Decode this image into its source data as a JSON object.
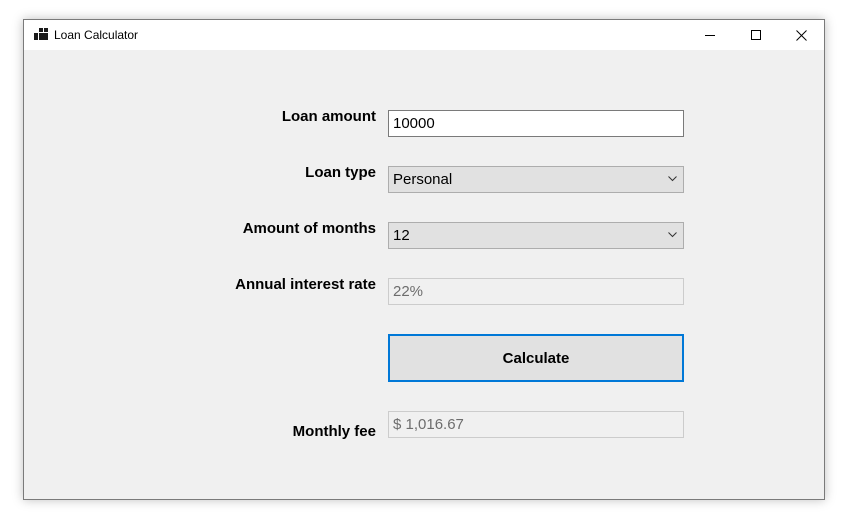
{
  "window": {
    "title": "Loan Calculator",
    "icon": "app-icon",
    "controls": {
      "minimize": "minimize-icon",
      "maximize": "maximize-icon",
      "close": "close-icon"
    }
  },
  "form": {
    "loan_amount": {
      "label": "Loan amount",
      "value": "10000"
    },
    "loan_type": {
      "label": "Loan type",
      "value": "Personal"
    },
    "months": {
      "label": "Amount of months",
      "value": "12"
    },
    "interest_rate": {
      "label": "Annual interest rate",
      "value": "22%"
    },
    "calculate_label": "Calculate",
    "monthly_fee": {
      "label": "Monthly fee",
      "value": "$ 1,016.67"
    }
  },
  "colors": {
    "accent": "#0078d7",
    "window_bg": "#f0f0f0",
    "combo_bg": "#e1e1e1"
  }
}
